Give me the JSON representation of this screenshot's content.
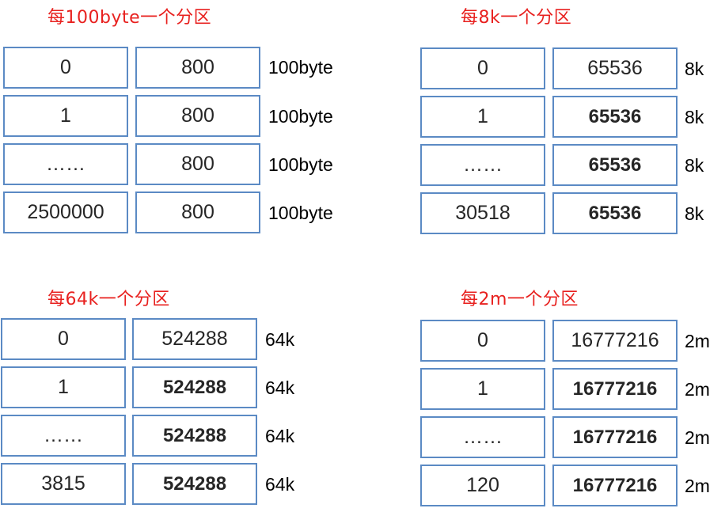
{
  "colors": {
    "title": "#e8211f",
    "cell_border": "#5b8ac4",
    "cell_text": "#262626",
    "label_text": "#000000"
  },
  "panels": [
    {
      "title": "每100byte一个分区",
      "rows": [
        {
          "index": "0",
          "size": "800",
          "unit": "100byte"
        },
        {
          "index": "1",
          "size": "800",
          "unit": "100byte"
        },
        {
          "index": "……",
          "size": "800",
          "unit": "100byte"
        },
        {
          "index": "2500000",
          "size": "800",
          "unit": "100byte"
        }
      ]
    },
    {
      "title": "每8k一个分区",
      "rows": [
        {
          "index": "0",
          "size": "65536",
          "unit": "8k"
        },
        {
          "index": "1",
          "size": "65536",
          "unit": "8k"
        },
        {
          "index": "……",
          "size": "65536",
          "unit": "8k"
        },
        {
          "index": "30518",
          "size": "65536",
          "unit": "8k"
        }
      ]
    },
    {
      "title": "每64k一个分区",
      "rows": [
        {
          "index": "0",
          "size": "524288",
          "unit": "64k"
        },
        {
          "index": "1",
          "size": "524288",
          "unit": "64k"
        },
        {
          "index": "……",
          "size": "524288",
          "unit": "64k"
        },
        {
          "index": "3815",
          "size": "524288",
          "unit": "64k"
        }
      ]
    },
    {
      "title": "每2m一个分区",
      "rows": [
        {
          "index": "0",
          "size": "16777216",
          "unit": "2m"
        },
        {
          "index": "1",
          "size": "16777216",
          "unit": "2m"
        },
        {
          "index": "……",
          "size": "16777216",
          "unit": "2m"
        },
        {
          "index": "120",
          "size": "16777216",
          "unit": "2m"
        }
      ]
    }
  ]
}
